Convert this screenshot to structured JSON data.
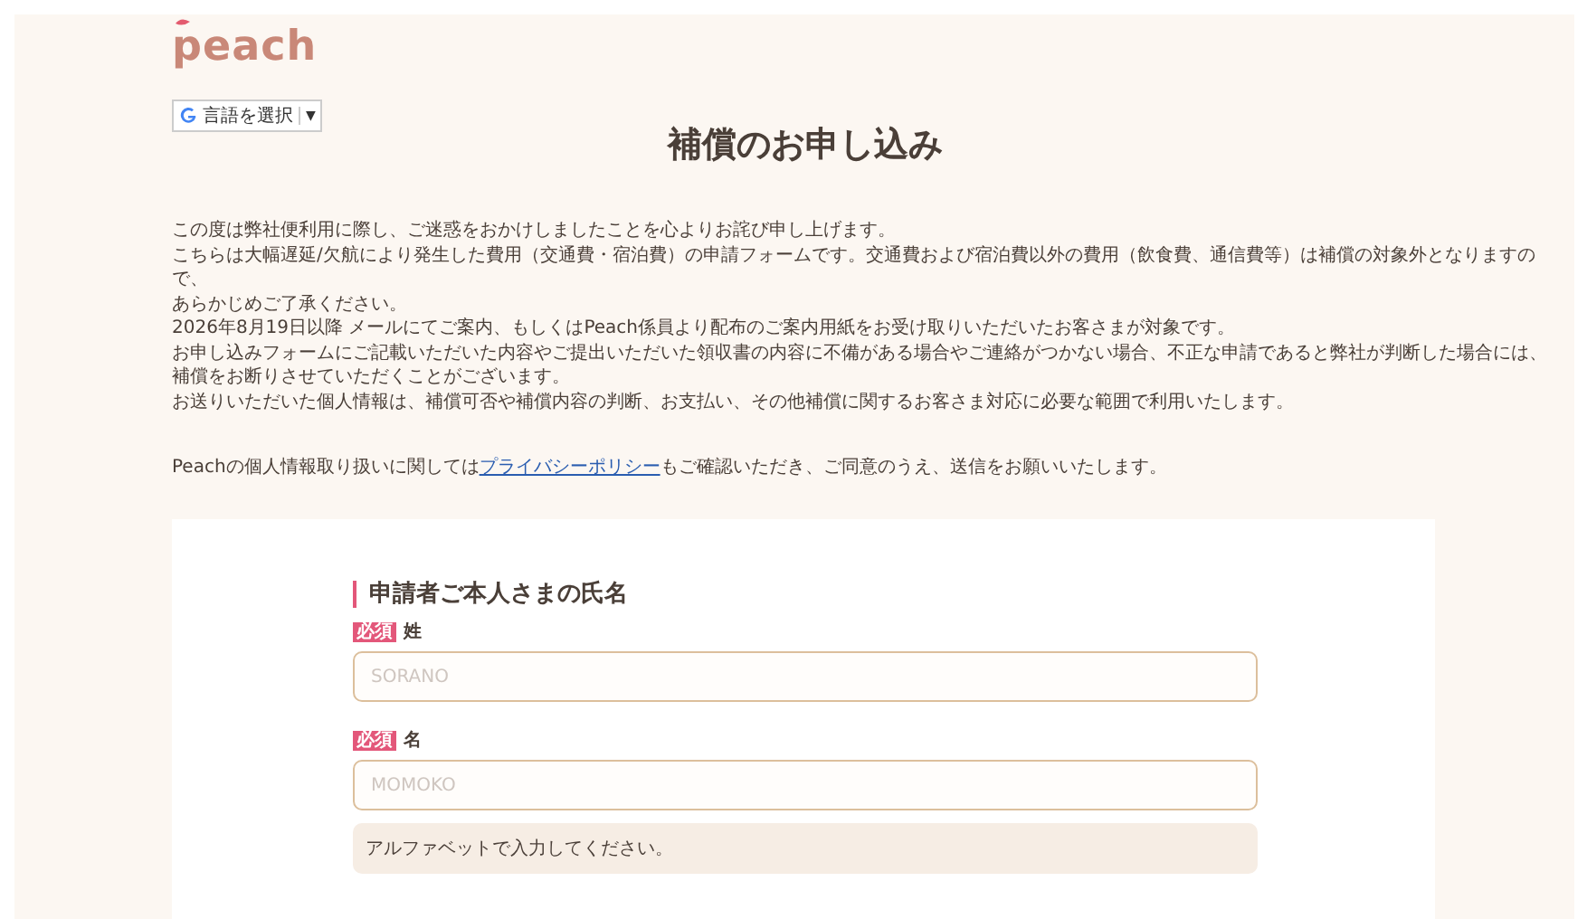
{
  "logo": "peach",
  "language_selector": {
    "label": "言語を選択",
    "caret": "▼"
  },
  "title": "補償のお申し込み",
  "intro_lines": [
    "この度は弊社便利用に際し、ご迷惑をおかけしましたことを心よりお詫び申し上げます。",
    "こちらは大幅遅延/欠航により発生した費用（交通費・宿泊費）の申請フォームです。交通費および宿泊費以外の費用（飲食費、通信費等）は補償の対象外となりますので、",
    "あらかじめご了承ください。",
    "2026年8月19日以降 メールにてご案内、もしくはPeach係員より配布のご案内用紙をお受け取りいただいたお客さまが対象です。",
    "お申し込みフォームにご記載いただいた内容やご提出いただいた領収書の内容に不備がある場合やご連絡がつかない場合、不正な申請であると弊社が判断した場合には、",
    "補償をお断りさせていただくことがございます。",
    "お送りいただいた個人情報は、補償可否や補償内容の判断、お支払い、その他補償に関するお客さま対応に必要な範囲で利用いたします。"
  ],
  "privacy_notice": {
    "before": "Peachの個人情報取り扱いに関しては",
    "link": "プライバシーポリシー",
    "after": "もご確認いただき、ご同意のうえ、送信をお願いいたします。"
  },
  "form_section": {
    "heading": "申請者ご本人さまの氏名",
    "fields": [
      {
        "label": "姓",
        "required": true,
        "required_badge": "必須",
        "placeholder": "SORANO"
      },
      {
        "label": "名",
        "required": true,
        "required_badge": "必須",
        "placeholder": "MOMOKO"
      }
    ],
    "note": "アルファベットで入力してください。"
  }
}
